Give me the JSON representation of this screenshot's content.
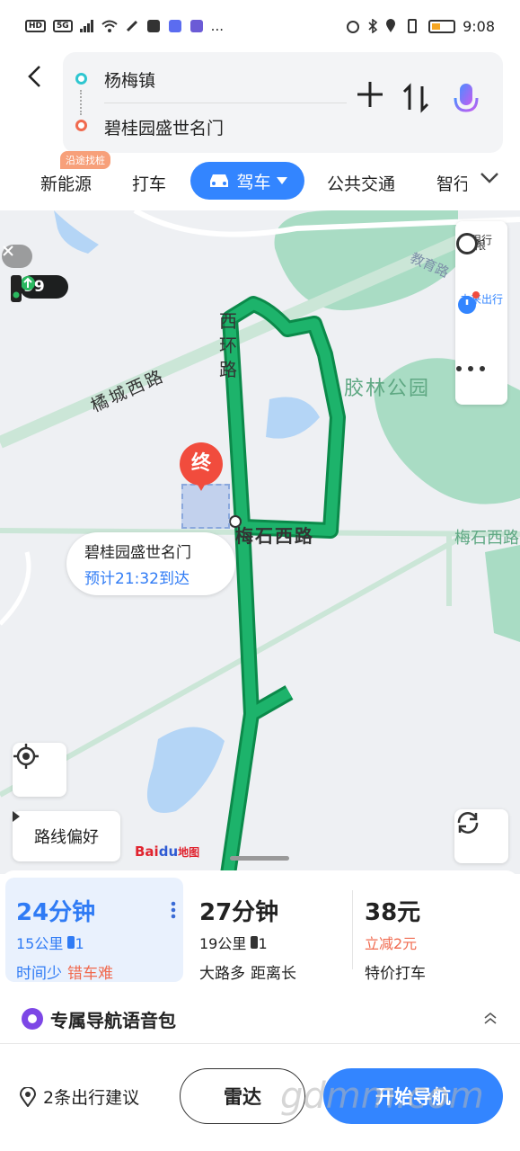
{
  "status_bar": {
    "left_icons": [
      "HD",
      "5G",
      "signal-icon",
      "wifi-icon",
      "nfc-icon",
      "app-icon",
      "music-icon",
      "edu-icon",
      "..."
    ],
    "time": "9:08"
  },
  "route": {
    "start": "杨梅镇",
    "end": "碧桂园盛世名门"
  },
  "tabs": {
    "items": [
      "新能源",
      "打车",
      "驾车",
      "公共交通",
      "智行"
    ],
    "active": "驾车",
    "badge": "沿途找桩"
  },
  "map": {
    "labels": {
      "road_1": "西环路",
      "road_2": "橘城西路",
      "road_3": "梅石西路",
      "road_4": "梅石西路",
      "road_5": "教育路",
      "park": "胶林公园"
    },
    "speed": "99",
    "controls": {
      "restrict": "限行",
      "restrict_icon_text": "限",
      "future_trip": "未来出行"
    },
    "end_pin": "终",
    "destination": {
      "name": "碧桂园盛世名门",
      "eta": "预计21:32到达"
    },
    "route_pref": "路线偏好",
    "logo_bai": "Bai",
    "logo_du": "du",
    "logo_map": "地图"
  },
  "routes": [
    {
      "time": "24分钟",
      "dist": "15公里",
      "lights": "1",
      "tag1": "时间少",
      "tag2": "错车难"
    },
    {
      "time": "27分钟",
      "dist": "19公里",
      "lights": "1",
      "tag1": "大路多",
      "tag2": "距离长"
    },
    {
      "time": "38元",
      "discount": "立减2元",
      "tag1": "特价打车"
    }
  ],
  "voice_pack": "专属导航语音包",
  "bottom": {
    "suggest": "2条出行建议",
    "radar": "雷达",
    "navigate": "开始导航",
    "watermark": "gdmm.com"
  },
  "colors": {
    "accent": "#3385ff",
    "route_green": "#1db36b",
    "destination_red": "#f14c3d",
    "eta_blue": "#2f7bf5"
  }
}
